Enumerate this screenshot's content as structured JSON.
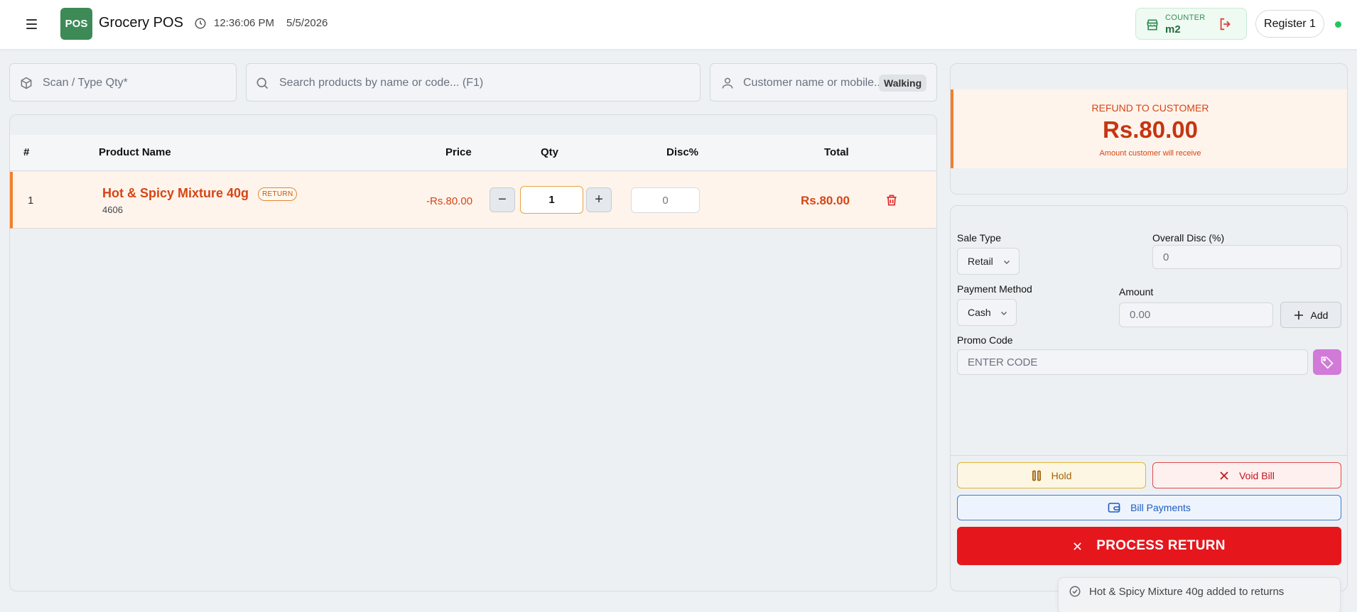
{
  "header": {
    "logo_text": "POS",
    "app_title": "Grocery POS",
    "time": "12:36:06 PM",
    "date": "5/5/2026",
    "counter_label": "COUNTER",
    "counter_value": "m2",
    "register_label": "Register 1",
    "status_color": "#22c55e"
  },
  "inputs": {
    "scan_placeholder": "Scan / Type Qty*",
    "search_placeholder": "Search products by name or code... (F1)",
    "customer_placeholder": "Customer name or mobile...",
    "customer_badge": "Walking"
  },
  "cart": {
    "columns": [
      "#",
      "Product Name",
      "Price",
      "Qty",
      "Disc%",
      "Total"
    ],
    "rows": [
      {
        "index": "1",
        "name": "Hot & Spicy Mixture 40g",
        "badge": "RETURN",
        "code": "4606",
        "price": "-Rs.80.00",
        "qty": "1",
        "disc": "0",
        "total": "Rs.80.00"
      }
    ]
  },
  "refund": {
    "label": "REFUND TO CUSTOMER",
    "amount": "Rs.80.00",
    "subtext": "Amount customer will receive"
  },
  "payment": {
    "sale_type_label": "Sale Type",
    "sale_type_value": "Retail",
    "overall_disc_label": "Overall Disc (%)",
    "overall_disc_value": "0",
    "payment_method_label": "Payment Method",
    "payment_method_value": "Cash",
    "amount_label": "Amount",
    "amount_placeholder": "0.00",
    "add_label": "Add",
    "promo_label": "Promo Code",
    "promo_placeholder": "ENTER CODE"
  },
  "actions": {
    "hold_label": "Hold",
    "void_label": "Void Bill",
    "bill_payments_label": "Bill Payments",
    "process_label": "PROCESS RETURN"
  },
  "toast": {
    "message": "Hot & Spicy Mixture 40g added to returns"
  },
  "colors": {
    "brand": "#3d8a57",
    "return_accent": "#f2802b",
    "process": "#e5171d"
  }
}
